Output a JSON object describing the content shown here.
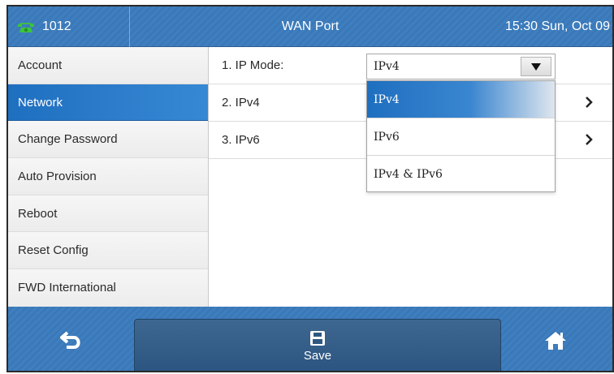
{
  "status_bar": {
    "line_number": "1012",
    "title": "WAN Port",
    "datetime": "15:30 Sun, Oct 09"
  },
  "sidebar": {
    "items": [
      {
        "label": "Account"
      },
      {
        "label": "Network",
        "active": true
      },
      {
        "label": "Change Password"
      },
      {
        "label": "Auto Provision"
      },
      {
        "label": "Reboot"
      },
      {
        "label": "Reset Config"
      },
      {
        "label": "FWD International"
      }
    ]
  },
  "main": {
    "rows": [
      {
        "label": "1. IP Mode:"
      },
      {
        "label": "2. IPv4"
      },
      {
        "label": "3. IPv6"
      }
    ],
    "ip_mode_select": {
      "value": "IPv4",
      "options": [
        "IPv4",
        "IPv6",
        "IPv4 & IPv6"
      ],
      "selected_index": 0
    }
  },
  "softkeys": {
    "back_icon": "back-arrow-icon",
    "save_label": "Save",
    "save_icon": "floppy-disk-icon",
    "home_icon": "home-icon"
  },
  "colors": {
    "accent_blue": "#1f6fc0",
    "bar_blue": "#3f7fbf",
    "softkey_dark": "#2b5480"
  }
}
